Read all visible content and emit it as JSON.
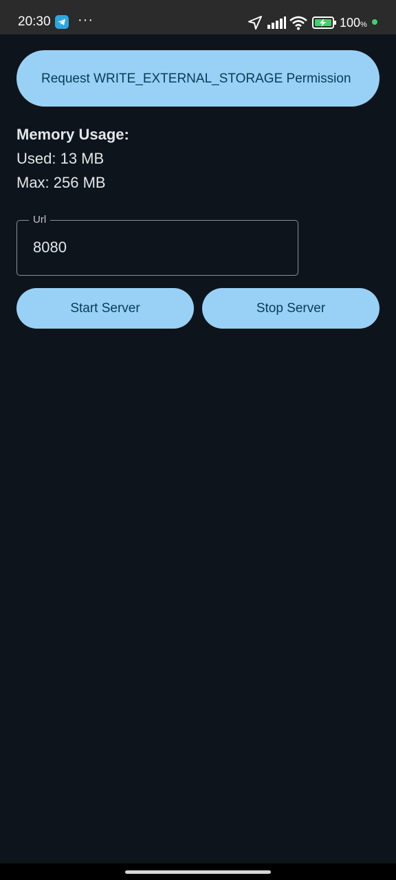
{
  "status_bar": {
    "time": "20:30",
    "dots": "···",
    "battery_percent": "100",
    "battery_unit": "%",
    "icons": [
      "telegram-icon",
      "location-arrow-icon",
      "signal-icon",
      "wifi-icon",
      "battery-charging-icon"
    ],
    "dot_color": "#3fd26a"
  },
  "permission_button": {
    "label": "Request WRITE_EXTERNAL_STORAGE Permission"
  },
  "memory": {
    "title": "Memory Usage:",
    "used": "Used: 13 MB",
    "max": "Max: 256 MB"
  },
  "url_field": {
    "label": "Url",
    "value": "8080"
  },
  "server_buttons": {
    "start_label": "Start Server",
    "stop_label": "Stop Server"
  },
  "colors": {
    "background": "#0e141b",
    "button_bg": "#99d1f6",
    "button_text": "#073b57"
  }
}
